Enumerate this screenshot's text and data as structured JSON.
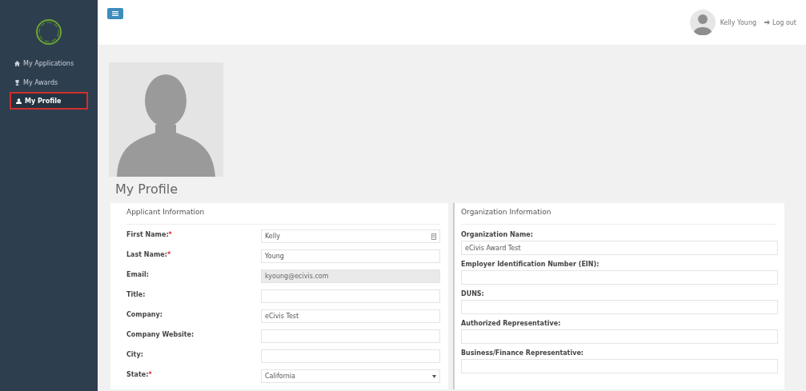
{
  "sidebar": {
    "items": [
      {
        "label": "My Applications",
        "selected": false
      },
      {
        "label": "My Awards",
        "selected": false
      },
      {
        "label": "My Profile",
        "selected": true
      }
    ]
  },
  "header": {
    "user_name": "Kelly Young",
    "logout": "Log out"
  },
  "page_title": "My Profile",
  "applicant": {
    "title": "Applicant Information",
    "fields": [
      {
        "label": "First Name:",
        "required_mark": "*",
        "kind": "input",
        "value": "Kelly",
        "disabled": false,
        "card_icon": true
      },
      {
        "label": "Last Name:",
        "required_mark": "*",
        "kind": "input",
        "value": "Young",
        "disabled": false,
        "card_icon": false
      },
      {
        "label": "Email:",
        "kind": "input",
        "value": "kyoung@ecivis.com",
        "disabled": true,
        "card_icon": false
      },
      {
        "label": "Title:",
        "kind": "input",
        "disabled": false,
        "card_icon": false
      },
      {
        "label": "Company:",
        "kind": "input",
        "value": "eCivis Test",
        "disabled": false,
        "card_icon": false
      },
      {
        "label": "Company Website:",
        "kind": "input",
        "disabled": false,
        "card_icon": false
      },
      {
        "label": "City:",
        "kind": "input",
        "disabled": false,
        "card_icon": false
      },
      {
        "label": "State:",
        "required_mark": "*",
        "kind": "select",
        "value": "California",
        "disabled": false,
        "card_icon": false
      }
    ]
  },
  "organization": {
    "title": "Organization Information",
    "fields": [
      {
        "label": "Organization Name:",
        "value": "eCivis Award Test"
      },
      {
        "label": "Employer Identification Number (EIN):"
      },
      {
        "label": "DUNS:"
      },
      {
        "label": "Authorized Representative:"
      },
      {
        "label": "Business/Finance Representative:"
      }
    ]
  }
}
